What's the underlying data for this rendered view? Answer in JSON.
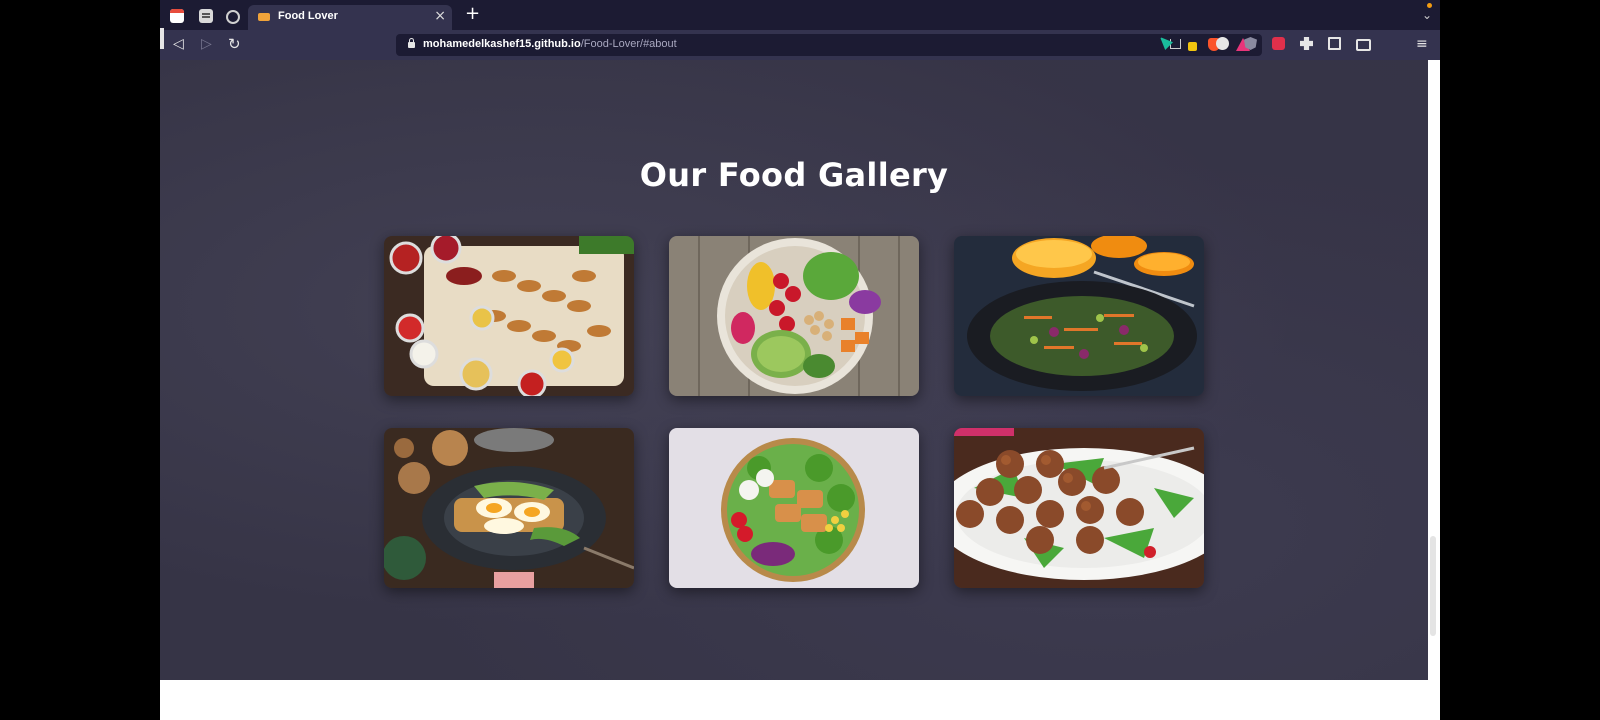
{
  "browser": {
    "pinned_tabs": [
      "calendar-icon",
      "document-icon",
      "globe-icon"
    ],
    "active_tab": {
      "title": "Food Lover",
      "favicon": "food-favicon-icon",
      "close": "×"
    },
    "new_tab": "+",
    "url": {
      "host": "mohamedelkashef15.github.io",
      "path": "/Food-Lover/#about"
    },
    "toolbar_icons": [
      "back-icon",
      "forward-icon",
      "reload-icon",
      "bookmark-icon",
      "share-icon",
      "brave-shields-icon",
      "brave-rewards-icon"
    ],
    "extension_icons": [
      "extension-1-icon",
      "extension-2-icon",
      "extension-3-icon",
      "extension-4-icon",
      "extension-5-icon",
      "puzzle-icon",
      "sidebar-icon",
      "wallet-icon"
    ],
    "menu": "≡"
  },
  "page": {
    "section_title": "Our Food Gallery",
    "gallery": [
      "grilled-skewers-with-sauces-image",
      "vegetable-bowl-with-avocado-image",
      "dark-plate-salad-with-orange-juice-image",
      "egg-avocado-toast-image",
      "chicken-salad-bowl-image",
      "meatballs-on-greens-image"
    ]
  },
  "colors": {
    "tab_strip": "#1c1b33",
    "toolbar": "#34334f",
    "page_background": "#363446",
    "title": "#ffffff"
  }
}
